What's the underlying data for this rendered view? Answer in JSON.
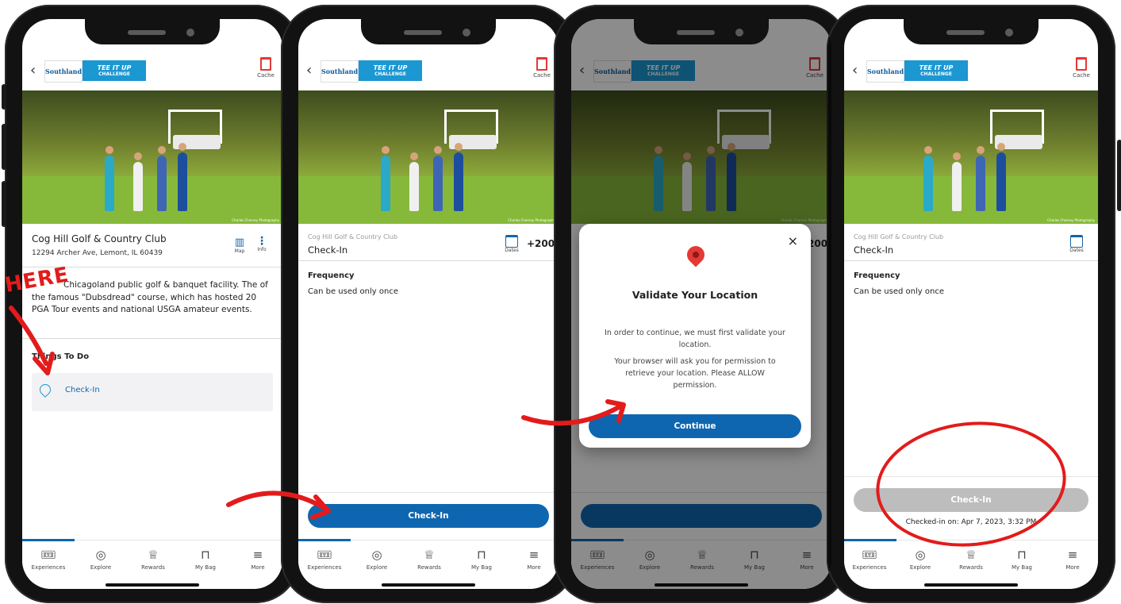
{
  "header": {
    "logo_top": "Southland",
    "logo_title": "TEE IT UP",
    "logo_sub": "CHALLENGE",
    "cache_label": "Cache"
  },
  "hero": {
    "credit": "Charles Cherney Photography"
  },
  "venue": {
    "title": "Cog Hill Golf & Country Club",
    "address": "12294 Archer Ave, Lemont, IL 60439",
    "map_label": "Map",
    "info_label": "Info",
    "description": "Chicagoland public golf & banquet facility. The   of the famous \"Dubsdread\" course, which has hosted 20 PGA Tour events and national USGA amateur events.",
    "things_heading": "Things To Do",
    "checkin_item": "Check-In"
  },
  "experience": {
    "subtitle": "Cog Hill Golf & Country Club",
    "title": "Check-In",
    "dates_label": "Dates",
    "points": "+200",
    "frequency_heading": "Frequency",
    "frequency_value": "Can be used only once",
    "checkin_button": "Check-In",
    "checked_in_text": "Checked-in on: Apr 7, 2023, 3:32 PM"
  },
  "modal": {
    "close": "×",
    "title": "Validate Your Location",
    "p1": "In order to continue, we must first validate your location.",
    "p2": "Your browser will ask you for permission to retrieve your location. Please ALLOW permission.",
    "button": "Continue"
  },
  "tabs": [
    {
      "label": "Experiences",
      "icon": "ticket-icon"
    },
    {
      "label": "Explore",
      "icon": "compass-icon"
    },
    {
      "label": "Rewards",
      "icon": "trophy-icon"
    },
    {
      "label": "My Bag",
      "icon": "bag-icon"
    },
    {
      "label": "More",
      "icon": "menu-icon"
    }
  ],
  "annotation": {
    "here": "HERE"
  },
  "colors": {
    "primary": "#0f66b0",
    "accent": "#1b97d2",
    "annotation_red": "#e31b1b",
    "disabled": "#bdbdbd"
  }
}
